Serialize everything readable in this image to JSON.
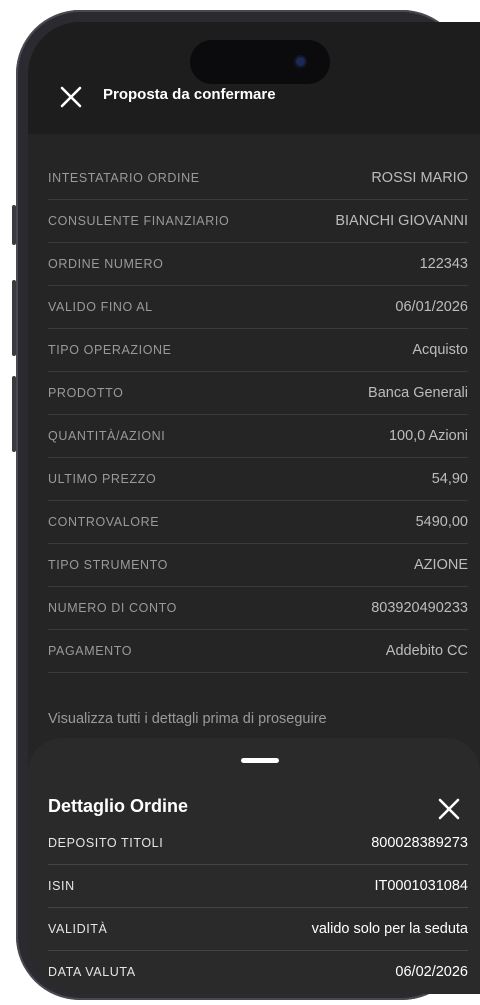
{
  "header": {
    "title": "Proposta da confermare",
    "close_icon": "close-icon"
  },
  "details": [
    {
      "label": "INTESTATARIO ORDINE",
      "value": "ROSSI MARIO"
    },
    {
      "label": "CONSULENTE FINANZIARIO",
      "value": "BIANCHI GIOVANNI"
    },
    {
      "label": "ORDINE NUMERO",
      "value": "122343"
    },
    {
      "label": "VALIDO FINO AL",
      "value": "06/01/2026"
    },
    {
      "label": "TIPO OPERAZIONE",
      "value": "Acquisto"
    },
    {
      "label": "PRODOTTO",
      "value": "Banca Generali"
    },
    {
      "label": "QUANTITÀ/AZIONI",
      "value": "100,0 Azioni"
    },
    {
      "label": "ULTIMO PREZZO",
      "value": "54,90"
    },
    {
      "label": "CONTROVALORE",
      "value": "5490,00"
    },
    {
      "label": "TIPO STRUMENTO",
      "value": "AZIONE"
    },
    {
      "label": "NUMERO DI CONTO",
      "value": "803920490233"
    },
    {
      "label": "PAGAMENTO",
      "value": "Addebito CC"
    }
  ],
  "hint": "Visualizza tutti i dettagli prima di proseguire",
  "sheet": {
    "title": "Dettaglio Ordine",
    "close_icon": "close-icon",
    "rows": [
      {
        "label": "DEPOSITO TITOLI",
        "value": "800028389273"
      },
      {
        "label": "ISIN",
        "value": "IT0001031084"
      },
      {
        "label": "VALIDITÀ",
        "value": "valido solo per la seduta"
      },
      {
        "label": "DATA VALUTA",
        "value": "06/02/2026"
      }
    ]
  },
  "colors": {
    "background": "#252525",
    "sheet": "#2a2a2a",
    "label": "#9a9a9a",
    "value": "#bcbcbc"
  }
}
